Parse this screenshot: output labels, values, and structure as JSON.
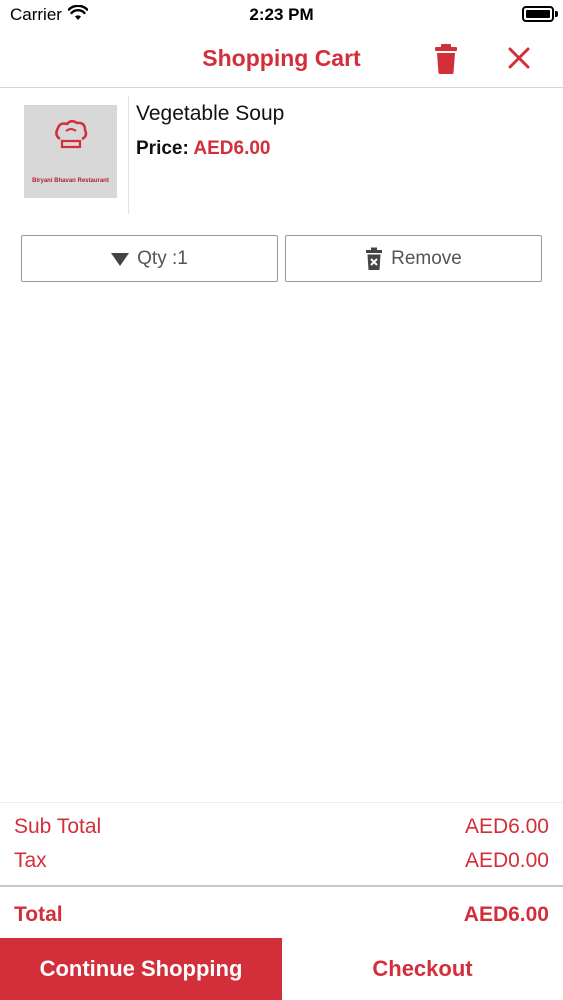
{
  "status_bar": {
    "carrier": "Carrier",
    "time": "2:23 PM"
  },
  "nav": {
    "title": "Shopping Cart",
    "trash_icon": "trash-icon",
    "close_icon": "close-icon"
  },
  "item": {
    "name": "Vegetable Soup",
    "price_label": "Price:",
    "price_value": "AED6.00",
    "thumbnail_caption": "Biryani Bhavan Restaurant",
    "qty_label": "Qty :1",
    "remove_label": "Remove"
  },
  "summary": {
    "subtotal_label": "Sub Total",
    "subtotal_value": "AED6.00",
    "tax_label": "Tax",
    "tax_value": "AED0.00",
    "total_label": "Total",
    "total_value": "AED6.00"
  },
  "actions": {
    "continue_label": "Continue Shopping",
    "checkout_label": "Checkout"
  },
  "colors": {
    "accent": "#d32f3a",
    "border": "#9a9a9a"
  }
}
